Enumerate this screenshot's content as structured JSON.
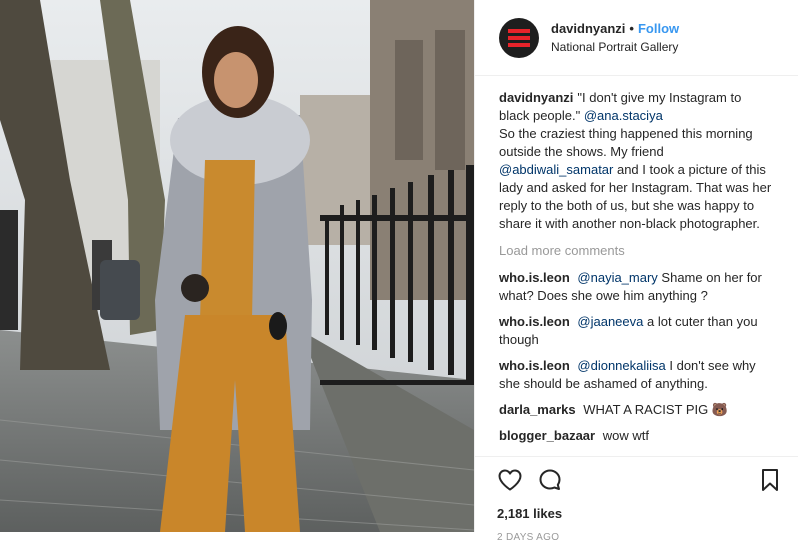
{
  "post": {
    "username": "davidnyanzi",
    "separator": "•",
    "follow_label": "Follow",
    "location": "National Portrait Gallery"
  },
  "caption": {
    "username": "davidnyanzi",
    "part1": "\"I don't give my Instagram to black people.\" ",
    "mention1": "@ana.staciya",
    "part2": "So the craziest thing happened this morning outside the shows. My friend ",
    "mention2": "@abdiwali_samatar",
    "part3": " and I took a picture of this lady and asked for her Instagram. That was her reply to the both of us, but she was happy to share it with another non-black photographer."
  },
  "load_more": "Load more comments",
  "comments": [
    {
      "username": "who.is.leon",
      "mention": "@nayia_mary",
      "text": " Shame on her for what? Does she owe him anything ?"
    },
    {
      "username": "who.is.leon",
      "mention": "@jaaneeva",
      "text": " a lot cuter than you though"
    },
    {
      "username": "who.is.leon",
      "mention": "@dionnekaliisa",
      "text": " I don't see why she should be ashamed of anything."
    },
    {
      "username": "darla_marks",
      "mention": "",
      "text": "WHAT A RACIST PIG 🐻"
    },
    {
      "username": "blogger_bazaar",
      "mention": "",
      "text": "wow wtf"
    }
  ],
  "icons": {
    "like": "heart-icon",
    "comment": "comment-bubble-icon",
    "save": "bookmark-icon"
  },
  "likes": "2,181 likes",
  "timestamp": "2 DAYS AGO",
  "colors": {
    "link": "#3897f0",
    "mention": "#003569",
    "muted": "#999999",
    "brand_red": "#e8232a"
  }
}
